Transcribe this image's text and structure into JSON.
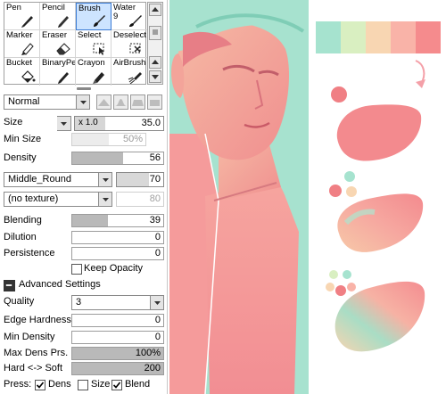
{
  "tools": [
    {
      "label": "Pen",
      "icon": "pen-icon"
    },
    {
      "label": "Pencil",
      "icon": "pencil-icon"
    },
    {
      "label": "Brush",
      "icon": "brush-icon",
      "selected": true
    },
    {
      "label": "Water\n9",
      "icon": "water-icon"
    },
    {
      "label": "Marker",
      "icon": "marker-icon"
    },
    {
      "label": "Eraser",
      "icon": "eraser-icon"
    },
    {
      "label": "Select",
      "icon": "select-icon"
    },
    {
      "label": "Deselect",
      "icon": "deselect-icon"
    },
    {
      "label": "Bucket",
      "icon": "bucket-icon"
    },
    {
      "label": "BinaryPe",
      "icon": "binary-pen-icon"
    },
    {
      "label": "Crayon",
      "icon": "crayon-icon"
    },
    {
      "label": "AirBrush",
      "icon": "airbrush-icon"
    }
  ],
  "blend_mode": "Normal",
  "size": {
    "label": "Size",
    "multiplier": "x 1.0",
    "value": "35.0"
  },
  "min_size": {
    "label": "Min Size",
    "value": "50%",
    "fraction": 0.5
  },
  "density": {
    "label": "Density",
    "value": "56",
    "fraction": 0.56
  },
  "brush_shape": {
    "value": "Middle_Round",
    "amount": "70"
  },
  "texture": {
    "value": "(no texture)",
    "amount": "80"
  },
  "blending": {
    "label": "Blending",
    "value": "39",
    "fraction": 0.39
  },
  "dilution": {
    "label": "Dilution",
    "value": "0",
    "fraction": 0
  },
  "persistence": {
    "label": "Persistence",
    "value": "0",
    "fraction": 0
  },
  "keep_opacity": {
    "label": "Keep Opacity",
    "checked": false
  },
  "advanced": {
    "label": "Advanced Settings",
    "expanded": true
  },
  "quality": {
    "label": "Quality",
    "value": "3"
  },
  "edge_hardness": {
    "label": "Edge Hardness",
    "value": "0",
    "fraction": 0
  },
  "min_density": {
    "label": "Min Density",
    "value": "0",
    "fraction": 0
  },
  "max_dens_prs": {
    "label": "Max Dens Prs.",
    "value": "100%",
    "fraction": 1.0
  },
  "hard_soft": {
    "label": "Hard <-> Soft",
    "value": "200",
    "fraction": 1.0
  },
  "press": {
    "label": "Press:",
    "dens": {
      "label": "Dens",
      "checked": true
    },
    "size": {
      "label": "Size",
      "checked": false
    },
    "blend": {
      "label": "Blend",
      "checked": true
    }
  },
  "palette": [
    "#a6e3cf",
    "#d9efc1",
    "#f8d6b2",
    "#f9b3a8",
    "#f58b8d"
  ],
  "colors": {
    "art_mint": "#a7e2cf",
    "art_pink": "#f49b9c",
    "art_skin": "#f6c4b0",
    "accent_red": "#f07f84",
    "arrow_pink": "#f4a0a8"
  }
}
